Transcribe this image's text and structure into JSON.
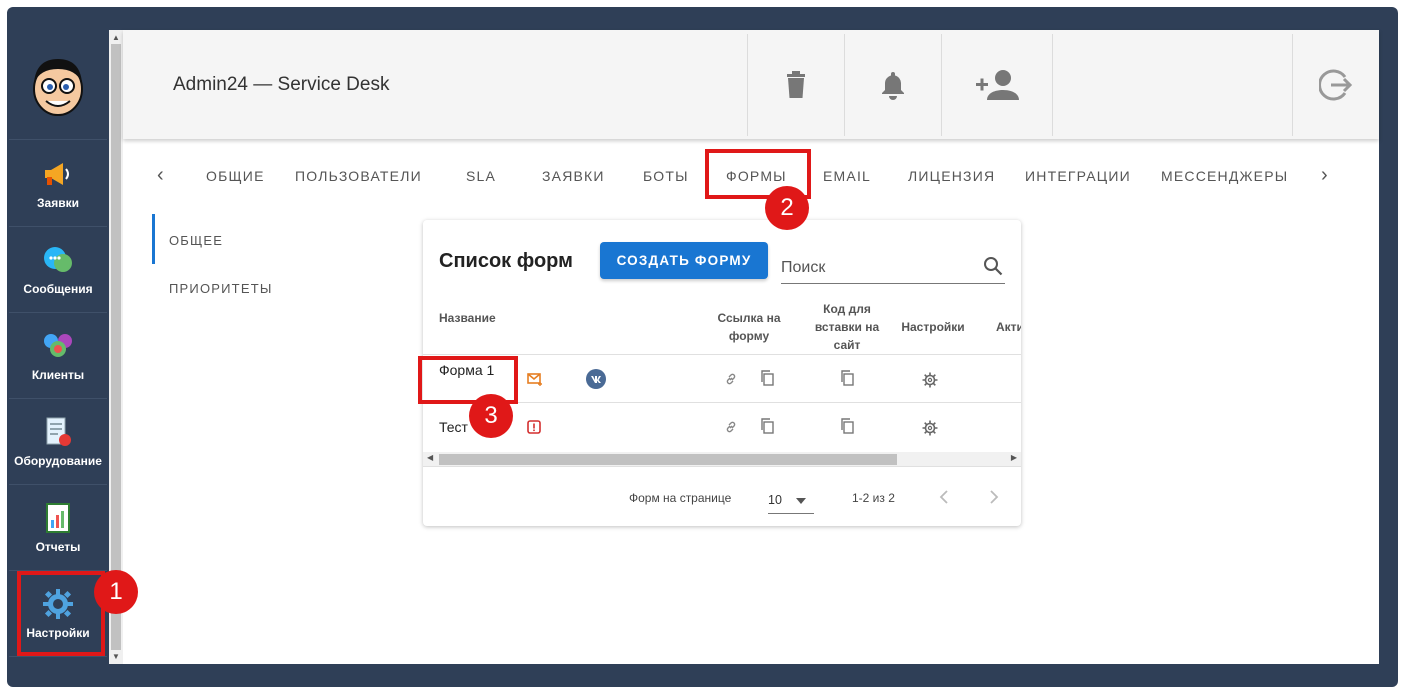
{
  "app": {
    "title": "Admin24 — Service Desk"
  },
  "sidebar": {
    "items": [
      {
        "label": "Заявки",
        "icon": "megaphone-icon"
      },
      {
        "label": "Сообщения",
        "icon": "chat-bubbles-icon"
      },
      {
        "label": "Клиенты",
        "icon": "clients-icon"
      },
      {
        "label": "Оборудование",
        "icon": "equipment-icon"
      },
      {
        "label": "Отчеты",
        "icon": "report-icon"
      },
      {
        "label": "Настройки",
        "icon": "gear-icon"
      }
    ]
  },
  "header": {
    "buttons": [
      "trash-icon",
      "bell-icon",
      "add-user-icon",
      "logout-icon"
    ]
  },
  "tabs": {
    "items": [
      "ОБЩИЕ",
      "ПОЛЬЗОВАТЕЛИ",
      "SLA",
      "ЗАЯВКИ",
      "БОТЫ",
      "ФОРМЫ",
      "EMAIL",
      "ЛИЦЕНЗИЯ",
      "ИНТЕГРАЦИИ",
      "МЕССЕНДЖЕРЫ"
    ],
    "active": "ФОРМЫ"
  },
  "subnav": {
    "items": [
      "ОБЩЕЕ",
      "ПРИОРИТЕТЫ"
    ],
    "active": "ОБЩЕЕ"
  },
  "forms_card": {
    "title": "Список форм",
    "create_label": "СОЗДАТЬ ФОРМУ",
    "search_placeholder": "Поиск",
    "columns": {
      "name": "Название",
      "link": "Ссылка на форму",
      "embed": "Код для вставки на сайт",
      "settings": "Настройки",
      "active": "Акти"
    },
    "rows": [
      {
        "name": "Форма 1",
        "status_icon": "mail-icon",
        "status_color": "#e67e22",
        "has_vk": true
      },
      {
        "name": "Тест",
        "status_icon": "alert-icon",
        "status_color": "#d32f2f",
        "has_vk": false
      }
    ],
    "footer": {
      "per_page_label": "Форм на странице",
      "per_page_value": "10",
      "range": "1-2 из 2"
    }
  },
  "annotations": {
    "badge1": "1",
    "badge2": "2",
    "badge3": "3"
  },
  "colors": {
    "accent": "#1976d2",
    "sidebar_bg": "#2f3f57",
    "highlight": "#e01818"
  }
}
